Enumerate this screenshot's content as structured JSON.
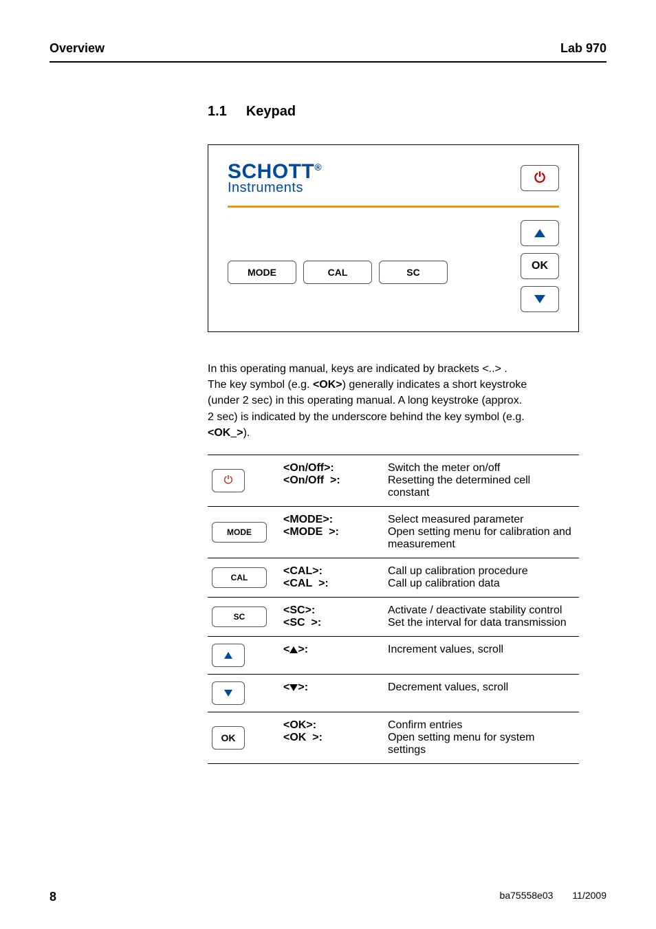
{
  "header": {
    "left": "Overview",
    "right": "Lab 970"
  },
  "section": {
    "number": "1.1",
    "title": "Keypad"
  },
  "brand": {
    "line1_main": "SCHOTT",
    "reg": "®",
    "line2": "Instruments"
  },
  "keys": {
    "mode": "MODE",
    "cal": "CAL",
    "sc": "SC",
    "ok": "OK"
  },
  "paragraph": {
    "l1": "In this operating manual, keys are indicated by brackets <..> .",
    "l2a": "The key symbol (e.g. ",
    "l2b": "<OK>",
    "l2c": ") generally indicates a short keystroke",
    "l3": "(under 2 sec) in this operating manual. A long keystroke (approx.",
    "l4": "2 sec) is indicated by the underscore behind the key symbol (e.g.",
    "l5a": "<OK",
    "l5b": ">",
    "l5c": ")."
  },
  "rows": {
    "onoff": {
      "l1": "<On/Off>:",
      "l2a": "<On/Off",
      "l2b": ">:",
      "d1": "Switch the meter on/off",
      "d2": "Resetting the determined cell constant"
    },
    "mode": {
      "l1": "<MODE>",
      "l2a": "<MODE",
      "l2b": ">",
      "d1": "Select measured parameter",
      "d2": "Open setting menu for calibration and",
      "d3": "measurement"
    },
    "cal": {
      "l1": "<CAL>",
      "l2a": "<CAL",
      "l2b": ">",
      "d1": "Call up calibration procedure",
      "d2": "Call up calibration data"
    },
    "sc": {
      "l1": "<SC>",
      "l2a": "<SC",
      "l2b": ">",
      "d1": "Activate / deactivate stability control",
      "d2": "Set the interval for data transmission"
    },
    "up": {
      "d": "Increment values, scroll"
    },
    "down": {
      "d": "Decrement values, scroll"
    },
    "ok": {
      "l1": "<OK>",
      "l2a": "<OK",
      "l2b": ">",
      "d1": "Confirm entries",
      "d2": "Open setting menu for system settings"
    }
  },
  "footer": {
    "page": "8",
    "doc": "ba75558e03",
    "date": "11/2009"
  }
}
